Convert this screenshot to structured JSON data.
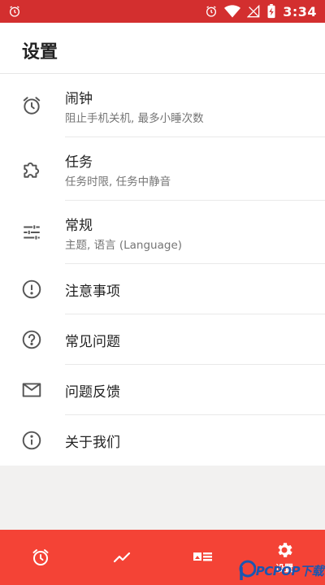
{
  "status_bar": {
    "time": "3:34",
    "icons": [
      "alarm-icon",
      "alarm-icon",
      "wifi-icon",
      "no-signal-icon",
      "battery-charging-icon"
    ]
  },
  "app_bar": {
    "title": "设置"
  },
  "settings": [
    {
      "icon": "alarm-clock-icon",
      "title": "闹钟",
      "subtitle": "阻止手机关机, 最多小睡次数"
    },
    {
      "icon": "puzzle-icon",
      "title": "任务",
      "subtitle": "任务时限, 任务中静音"
    },
    {
      "icon": "tune-icon",
      "title": "常规",
      "subtitle": "主题, 语言 (Language)"
    },
    {
      "icon": "alert-circle-icon",
      "title": "注意事项"
    },
    {
      "icon": "help-circle-icon",
      "title": "常见问题"
    },
    {
      "icon": "mail-icon",
      "title": "问题反馈"
    },
    {
      "icon": "info-circle-icon",
      "title": "关于我们"
    }
  ],
  "bottom_nav": [
    {
      "icon": "alarm-icon",
      "label": ""
    },
    {
      "icon": "trending-icon",
      "label": ""
    },
    {
      "icon": "news-card-icon",
      "label": ""
    },
    {
      "icon": "gear-icon",
      "label": "设置",
      "selected": true
    }
  ],
  "watermark": {
    "text": "PCPOP下载"
  },
  "colors": {
    "status_bar": "#d32f2f",
    "bottom_bar": "#f44336",
    "background": "#f2f1f0",
    "icon": "#555555"
  }
}
